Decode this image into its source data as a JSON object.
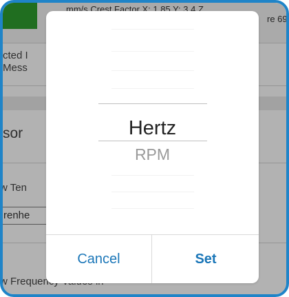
{
  "background": {
    "top_bar_text": "mm/s    Crest Factor X: 1.85 Y: 3.4 Z",
    "top_bar_text_2": "re 69",
    "row1_line1": "cted I",
    "row1_line2": "Mess",
    "section_label": "sor",
    "temp_label": "w Ten",
    "temp_input_value": "renhe",
    "freq_label": "w Frequency Values in"
  },
  "picker": {
    "options": [
      "Hertz",
      "RPM"
    ],
    "selected": "Hertz"
  },
  "buttons": {
    "cancel": "Cancel",
    "set": "Set"
  },
  "colors": {
    "accent": "#1a76b8",
    "frame": "#1f84c8",
    "status_green": "#2e9e2e"
  }
}
